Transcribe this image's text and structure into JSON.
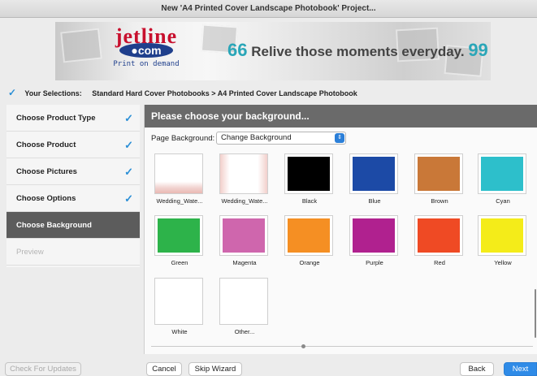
{
  "window": {
    "title": "New 'A4 Printed Cover Landscape Photobook' Project..."
  },
  "banner": {
    "logo_word": "jetline",
    "logo_com": "com",
    "logo_tagline": "Print on demand",
    "quote_open": "66",
    "tagline": "Relive those moments everyday.",
    "quote_close": "99"
  },
  "selections": {
    "label": "Your Selections:",
    "path": "Standard Hard Cover Photobooks > A4 Printed Cover Landscape Photobook"
  },
  "steps": [
    {
      "label": "Choose Product Type",
      "done": true
    },
    {
      "label": "Choose Product",
      "done": true
    },
    {
      "label": "Choose Pictures",
      "done": true
    },
    {
      "label": "Choose Options",
      "done": true
    },
    {
      "label": "Choose Background",
      "active": true
    },
    {
      "label": "Preview",
      "disabled": true
    }
  ],
  "panel": {
    "heading": "Please choose your background...",
    "page_background_label": "Page Background:",
    "page_background_value": "Change Background"
  },
  "backgrounds": [
    {
      "name": "Wedding_Wate...",
      "kind": "image"
    },
    {
      "name": "Wedding_Wate...",
      "kind": "image"
    },
    {
      "name": "Black",
      "color": "#000000"
    },
    {
      "name": "Blue",
      "color": "#1c4aa6"
    },
    {
      "name": "Brown",
      "color": "#c97838"
    },
    {
      "name": "Cyan",
      "color": "#2dbfcb"
    },
    {
      "name": "Green",
      "color": "#2db34a"
    },
    {
      "name": "Magenta",
      "color": "#cf66ad"
    },
    {
      "name": "Orange",
      "color": "#f58f23"
    },
    {
      "name": "Purple",
      "color": "#b0218f"
    },
    {
      "name": "Red",
      "color": "#ef4a24"
    },
    {
      "name": "Yellow",
      "color": "#f4ec19"
    },
    {
      "name": "White",
      "color": "#ffffff"
    },
    {
      "name": "Other...",
      "color": "#ffffff"
    }
  ],
  "footer": {
    "check_updates": "Check For Updates",
    "cancel": "Cancel",
    "skip_wizard": "Skip Wizard",
    "back": "Back",
    "next": "Next"
  },
  "colors": {
    "accent": "#2f8be7",
    "check": "#2b8fd6",
    "active_step": "#5c5c5c"
  }
}
